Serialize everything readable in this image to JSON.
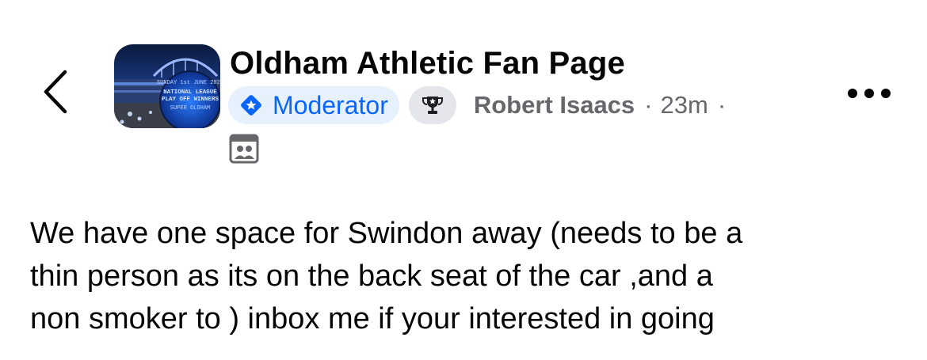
{
  "header": {
    "group_name": "Oldham Athletic Fan Page",
    "role_badge": "Moderator",
    "author": "Robert Isaacs",
    "separator": "·",
    "timestamp": "23m",
    "timestamp_suffix": "·",
    "icons": {
      "back": "chevron-left-icon",
      "role": "moderator-shield-icon",
      "award": "trophy-icon",
      "audience": "group-audience-icon",
      "more": "more-horizontal-icon"
    },
    "avatar_banner": {
      "line1": "SUNDAY 1st JUNE 2025",
      "line2": "NATIONAL LEAGUE",
      "line3": "PLAY OFF WINNERS",
      "line4": "SUPER OLDHAM"
    }
  },
  "post": {
    "text": "We have one space for Swindon away (needs to be a\nthin person as its on the back seat of the car ,and a\nnon smoker to ) inbox me if your interested  in going"
  },
  "colors": {
    "moderator_text": "#0866ff",
    "moderator_bg": "#e7f0fd",
    "secondary_text": "#65676b",
    "badge_grey": "#e4e6eb"
  }
}
